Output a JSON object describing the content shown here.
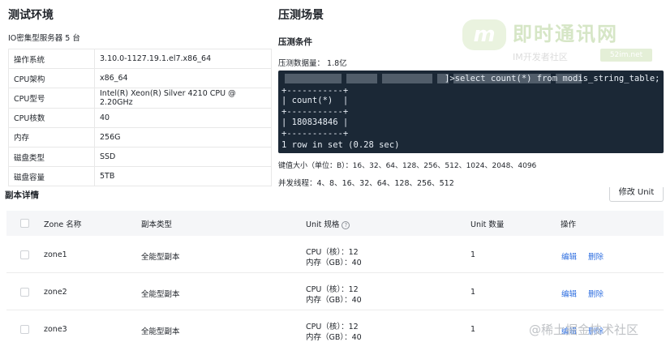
{
  "env": {
    "title": "测试环境",
    "subtitle": "IO密集型服务器 5 台",
    "rows": [
      {
        "k": "操作系统",
        "v": "3.10.0-1127.19.1.el7.x86_64"
      },
      {
        "k": "CPU架构",
        "v": "x86_64"
      },
      {
        "k": "CPU型号",
        "v": "Intel(R) Xeon(R) Silver 4210 CPU @ 2.20GHz"
      },
      {
        "k": "CPU核数",
        "v": "40"
      },
      {
        "k": "内存",
        "v": "256G"
      },
      {
        "k": "磁盘类型",
        "v": "SSD"
      },
      {
        "k": "磁盘容量",
        "v": "5TB"
      }
    ]
  },
  "scenario": {
    "title": "压测场景",
    "conditions_title": "压测条件",
    "data_volume": "压测数据量： 1.8亿",
    "terminal": {
      "line1": "]>select count(*) from modis_string_table;",
      "line2": "+-----------+",
      "line3": "| count(*)  |",
      "line4": "+-----------+",
      "line5": "| 180834846 |",
      "line6": "+-----------+",
      "line7": "1 row in set (0.28 sec)"
    },
    "key_size": "键值大小（单位：B）：16、32、64、128、256、512、1024、2048、4096",
    "threads": "并发线程：4、8、16、32、64、128、256、512"
  },
  "watermark": {
    "logo": "m",
    "big": "即时通讯网",
    "small": "IM开发者社区",
    "badge": "52im.net"
  },
  "replica": {
    "title": "副本详情",
    "modify_button": "修改 Unit",
    "headers": {
      "zone": "Zone 名称",
      "type": "副本类型",
      "unit": "Unit 规格",
      "count": "Unit 数量",
      "action": "操作",
      "help": "?"
    },
    "rows": [
      {
        "zone": "zone1",
        "type": "全能型副本",
        "cpu": "CPU（核）：12",
        "mem": "内存（GB）：40",
        "count": "1",
        "edit": "编辑",
        "delete": "删除"
      },
      {
        "zone": "zone2",
        "type": "全能型副本",
        "cpu": "CPU（核）：12",
        "mem": "内存（GB）：40",
        "count": "1",
        "edit": "编辑",
        "delete": "删除"
      },
      {
        "zone": "zone3",
        "type": "全能型副本",
        "cpu": "CPU（核）：12",
        "mem": "内存（GB）：40",
        "count": "1",
        "edit": "编辑",
        "delete": "删除"
      }
    ]
  },
  "juejin": "@稀土掘金技术社区"
}
